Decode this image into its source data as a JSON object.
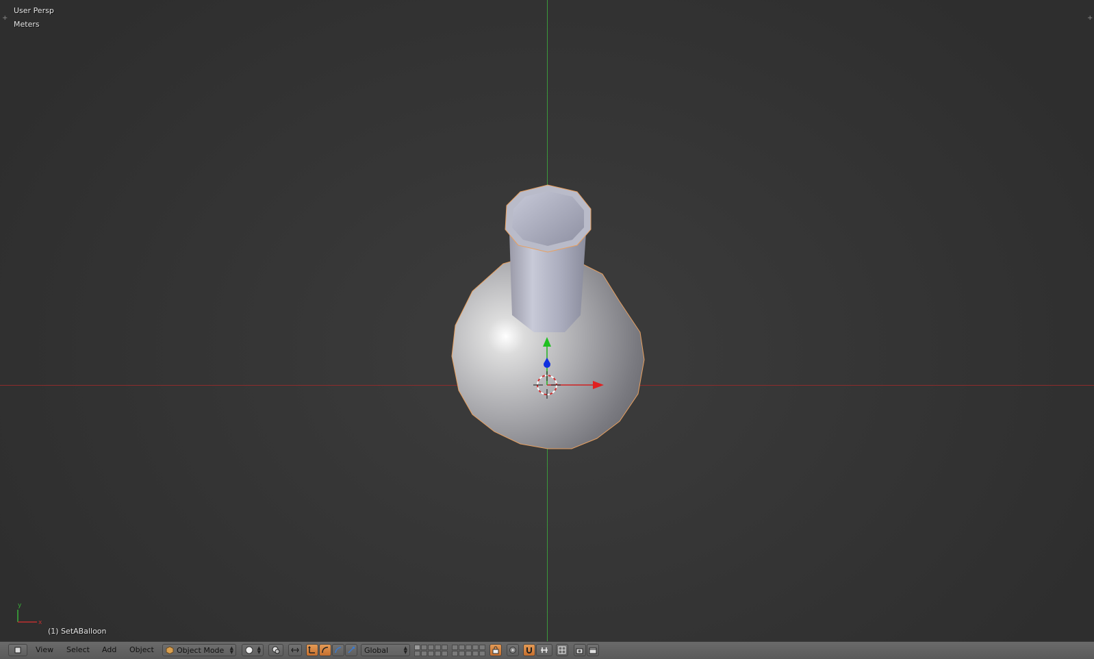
{
  "viewport": {
    "perspective_label": "User Persp",
    "units_label": "Meters",
    "object_label": "(1) SetABalloon",
    "mini_axis_y": "y",
    "mini_axis_x": "x"
  },
  "header": {
    "menus": {
      "view": "View",
      "select": "Select",
      "add": "Add",
      "object": "Object"
    },
    "mode": {
      "label": "Object Mode",
      "icon": "cube-icon"
    },
    "pivot_icon": "circle-icon",
    "orientation": {
      "label": "Global"
    },
    "active_layer": 1,
    "icons": [
      "editor-type-icon",
      "viewport-shading-icon",
      "pivot-point-icon",
      "manipulator-icon",
      "translate-icon",
      "rotate-icon",
      "scale-icon",
      "layers-icon",
      "lock-icon",
      "proportional-edit-icon",
      "snap-icon",
      "snap-element-icon",
      "render-icon",
      "render-animation-icon"
    ]
  },
  "colors": {
    "background": "#393939",
    "x_axis": "#8e2c2c",
    "y_axis": "#3b9b3b",
    "selection_outline": "#e8a060",
    "header_bg": "#606060"
  }
}
